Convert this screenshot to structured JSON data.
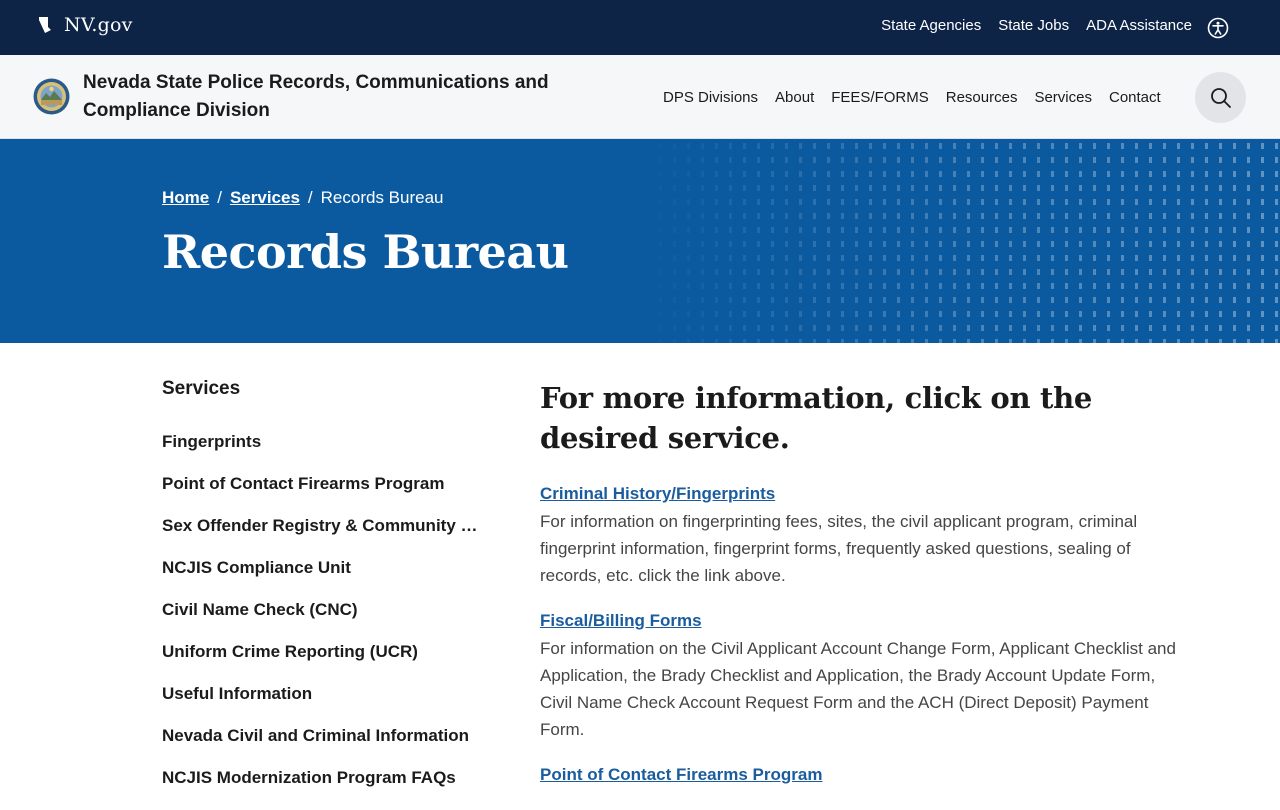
{
  "utility": {
    "brand": "NV.gov",
    "links": [
      "State Agencies",
      "State Jobs",
      "ADA Assistance"
    ]
  },
  "header": {
    "site_title": "Nevada State Police Records, Communications and Compliance Division",
    "nav": [
      "DPS Divisions",
      "About",
      "FEES/FORMS",
      "Resources",
      "Services",
      "Contact"
    ]
  },
  "hero": {
    "breadcrumb": {
      "home": "Home",
      "services": "Services",
      "sep": "/",
      "current": "Records Bureau"
    },
    "title": "Records Bureau"
  },
  "sidebar": {
    "heading": "Services",
    "items": [
      "Fingerprints",
      "Point of Contact Firearms Program",
      "Sex Offender Registry & Community Notification",
      "NCJIS Compliance Unit",
      "Civil Name Check (CNC)",
      "Uniform Crime Reporting (UCR)",
      "Useful Information",
      "Nevada Civil and Criminal Information",
      "NCJIS Modernization Program FAQs"
    ]
  },
  "main": {
    "heading": "For more information, click on the desired service.",
    "services": [
      {
        "title": "Criminal History/Fingerprints",
        "desc": "For information on fingerprinting fees, sites, the civil applicant program, criminal fingerprint information, fingerprint forms, frequently asked questions, sealing of records, etc. click the link above."
      },
      {
        "title": "Fiscal/Billing Forms",
        "desc": "For information on the Civil Applicant Account Change Form, Applicant Checklist and Application, the Brady Checklist and Application, the Brady Account Update Form, Civil Name Check Account Request Form and the ACH (Direct Deposit) Payment Form."
      },
      {
        "title": "Point of Contact Firearms Program",
        "desc": ""
      }
    ]
  },
  "colors": {
    "utility_bg": "#0e2447",
    "hero_bg": "#0b5aa0",
    "link": "#1a5c9e"
  }
}
